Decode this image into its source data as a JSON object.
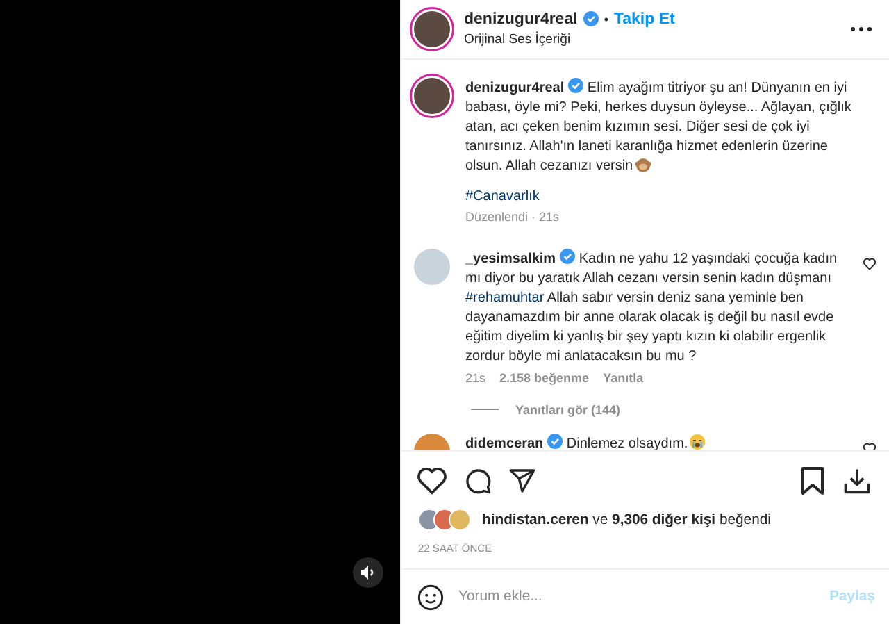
{
  "video": {
    "muted": false
  },
  "header": {
    "username": "denizugur4real",
    "verified": true,
    "separator": "•",
    "follow": "Takip Et",
    "subtitle": "Orijinal Ses İçeriği"
  },
  "caption": {
    "username": "denizugur4real",
    "verified": true,
    "text": "Elim ayağım titriyor şu an! Dünyanın en iyi babası, öyle mi? Peki, herkes duysun öyleyse... Ağlayan, çığlık atan, acı çeken benim kızımın sesi. Diğer sesi de çok iyi tanırsınız. Allah'ın laneti karanlığa hizmet edenlerin üzerine olsun. Allah cezanızı versin",
    "emoji": true,
    "hashtag": "#Canavarlık",
    "meta": "Düzenlendi · 21s"
  },
  "comments": [
    {
      "username": "_yesimsalkim",
      "verified": true,
      "segments": [
        {
          "kind": "text",
          "text": "Kadın ne yahu 12 yaşındaki çocuğa kadın mı diyor bu yaratık Allah cezanı versin senin kadın düşmanı "
        },
        {
          "kind": "tag",
          "text": "#rehamuhtar"
        },
        {
          "kind": "text",
          "text": " Allah sabır versin deniz sana yeminle ben dayanamazdım bir anne olarak olacak iş değil bu nasıl evde eğitim diyelim ki yanlış bir şey yaptı kızın ki olabilir ergenlik zordur böyle mi anlatacaksın bu mu ?"
        }
      ],
      "emoji": false,
      "liked": false,
      "time": "21s",
      "likes": "2.158 beğenme",
      "reply": "Yanıtla",
      "replies": "Yanıtları gör (144)"
    },
    {
      "username": "didemceran",
      "verified": true,
      "segments": [
        {
          "kind": "text",
          "text": "Dinlemez olsaydım."
        }
      ],
      "emoji": true,
      "liked": false
    }
  ],
  "actions": {
    "liked": false,
    "saved": false
  },
  "likes_text": "**hindistan.ceren** ve **9,306 diğer kişi** beğendi",
  "time": "22 SAAT ÖNCE",
  "comment_box": {
    "placeholder": "Yorum ekle...",
    "post": "Paylaş",
    "disabled": true
  }
}
